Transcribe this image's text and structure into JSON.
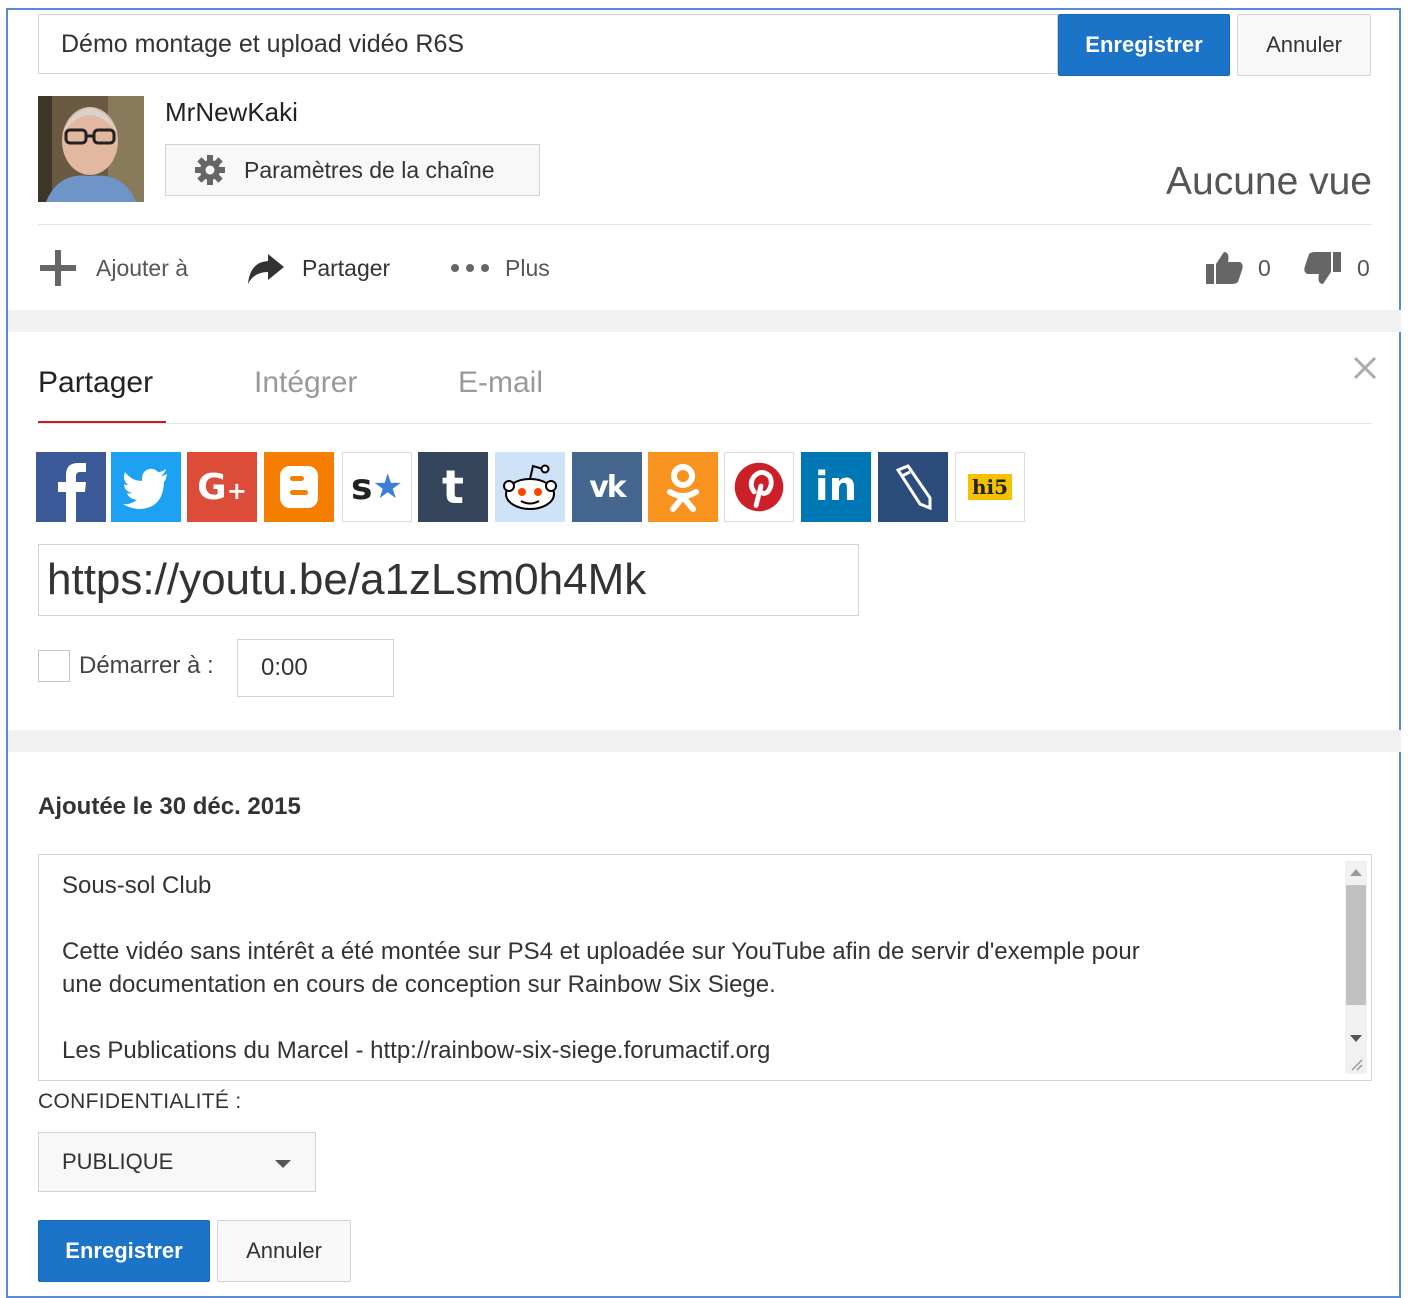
{
  "header": {
    "title_value": "Démo montage et upload vidéo R6S",
    "save_label": "Enregistrer",
    "cancel_label": "Annuler"
  },
  "channel": {
    "name": "MrNewKaki",
    "settings_label": "Paramètres de la chaîne",
    "views": "Aucune vue"
  },
  "actions": {
    "add_label": "Ajouter à",
    "share_label": "Partager",
    "more_label": "Plus",
    "likes": "0",
    "dislikes": "0"
  },
  "share_panel": {
    "tabs": [
      "Partager",
      "Intégrer",
      "E-mail"
    ],
    "active_tab": "Partager",
    "social_icons": [
      "facebook-icon",
      "twitter-icon",
      "google-plus-icon",
      "blogger-icon",
      "stumbleupon-icon",
      "tumblr-icon",
      "reddit-icon",
      "vk-icon",
      "odnoklassniki-icon",
      "pinterest-icon",
      "linkedin-icon",
      "livejournal-icon",
      "hi5-icon"
    ],
    "url": "https://youtu.be/a1zLsm0h4Mk",
    "start_label": "Démarrer à :",
    "start_time": "0:00"
  },
  "details": {
    "added_date": "Ajoutée le 30 déc. 2015",
    "description_lines": [
      "Sous-sol Club",
      "",
      "Cette vidéo sans intérêt a été montée sur PS4 et uploadée sur YouTube afin de servir d'exemple pour",
      "une documentation en cours de conception sur Rainbow Six Siege.",
      "",
      "Les Publications du Marcel - http://rainbow-six-siege.forumactif.org"
    ],
    "privacy_label": "CONFIDENTIALITÉ :",
    "privacy_value": "PUBLIQUE",
    "save_label": "Enregistrer",
    "cancel_label": "Annuler"
  },
  "colors": {
    "primary_blue": "#1b74c8",
    "tab_underline": "#cc181e",
    "frame_border": "#5b8bd0"
  }
}
